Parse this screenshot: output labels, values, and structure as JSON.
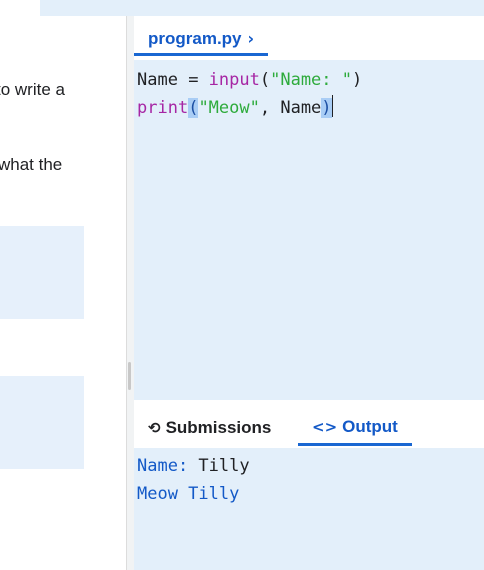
{
  "instructions": {
    "line1_fragment": "to write a",
    "line2_fragment": "what the"
  },
  "editor": {
    "file_tab_label": "program.py",
    "code_lines": [
      {
        "var": "Name",
        "op": " = ",
        "fn": "input",
        "open": "(",
        "str": "\"Name: \"",
        "close": ")"
      },
      {
        "fn": "print",
        "open": "(",
        "str": "\"Meow\"",
        "sep": ", ",
        "arg": "Name",
        "close": ")"
      }
    ]
  },
  "bottom_tabs": {
    "submissions_label": "Submissions",
    "output_label": "Output"
  },
  "output": {
    "prompt": "Name: ",
    "user_input": "Tilly",
    "line2": "Meow Tilly"
  },
  "colors": {
    "accent": "#1967d2",
    "panel_bg": "#e3effa",
    "keyword": "#a626a4",
    "string": "#2eab3c"
  }
}
